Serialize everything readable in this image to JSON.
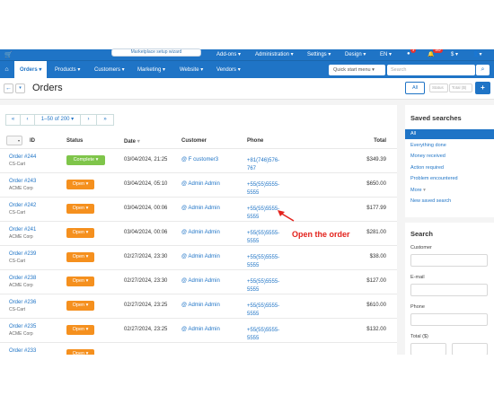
{
  "wizard_tab": "Marketplace setup wizard",
  "topbar": {
    "cart_icon": "shopping-cart-icon",
    "items": [
      "Add-ons",
      "Administration",
      "Settings",
      "Design",
      "EN"
    ],
    "notif_badge": "3",
    "mail_badge": "182",
    "currency": "$"
  },
  "secbar": {
    "items": [
      "Orders",
      "Products",
      "Customers",
      "Marketing",
      "Website",
      "Vendors"
    ],
    "quick_start": "Quick start menu",
    "search_placeholder": "Search"
  },
  "titlebar": {
    "title": "Orders",
    "all_label": "All",
    "field1": "Status",
    "field2": "Total ($)"
  },
  "pager": {
    "first": "«",
    "prev": "‹",
    "range": "1–50 of 200",
    "next": "›",
    "last": "»"
  },
  "table": {
    "headers": {
      "id": "ID",
      "status": "Status",
      "date": "Date",
      "customer": "Customer",
      "phone": "Phone",
      "total": "Total"
    },
    "rows": [
      {
        "order": "Order #244",
        "company": "CS-Cart",
        "status": "Complete",
        "date": "03/04/2024, 21:25",
        "customer": "F customer3",
        "phone": "+81(746)576-767",
        "total": "$349.39"
      },
      {
        "order": "Order #243",
        "company": "ACME Corp",
        "status": "Open",
        "date": "03/04/2024, 05:10",
        "customer": "Admin Admin",
        "phone": "+55(55)5555-5555",
        "total": "$650.00"
      },
      {
        "order": "Order #242",
        "company": "CS-Cart",
        "status": "Open",
        "date": "03/04/2024, 00:06",
        "customer": "Admin Admin",
        "phone": "+55(55)5555-5555",
        "total": "$177.99"
      },
      {
        "order": "Order #241",
        "company": "ACME Corp",
        "status": "Open",
        "date": "03/04/2024, 00:06",
        "customer": "Admin Admin",
        "phone": "+55(55)5555-5555",
        "total": "$281.00"
      },
      {
        "order": "Order #239",
        "company": "CS-Cart",
        "status": "Open",
        "date": "02/27/2024, 23:30",
        "customer": "Admin Admin",
        "phone": "+55(55)5555-5555",
        "total": "$38.00"
      },
      {
        "order": "Order #238",
        "company": "ACME Corp",
        "status": "Open",
        "date": "02/27/2024, 23:30",
        "customer": "Admin Admin",
        "phone": "+55(55)5555-5555",
        "total": "$127.00"
      },
      {
        "order": "Order #236",
        "company": "CS-Cart",
        "status": "Open",
        "date": "02/27/2024, 23:25",
        "customer": "Admin Admin",
        "phone": "+55(55)5555-5555",
        "total": "$610.00"
      },
      {
        "order": "Order #235",
        "company": "ACME Corp",
        "status": "Open",
        "date": "02/27/2024, 23:25",
        "customer": "Admin Admin",
        "phone": "+55(55)5555-5555",
        "total": "$132.00"
      },
      {
        "order": "Order #233",
        "company": "",
        "status": "Open",
        "date": "",
        "customer": "",
        "phone": "",
        "total": ""
      }
    ]
  },
  "annotation": "Open the order",
  "saved_searches": {
    "title": "Saved searches",
    "items": [
      "All",
      "Everything done",
      "Money received",
      "Action required",
      "Problem encountered",
      "More",
      "New saved search"
    ]
  },
  "search_panel": {
    "title": "Search",
    "labels": [
      "Customer",
      "E-mail",
      "Phone",
      "Total ($)"
    ]
  },
  "colors": {
    "brand": "#1f74c6",
    "open": "#f5901e",
    "complete": "#7fc54a",
    "annotation": "#e3221c"
  }
}
